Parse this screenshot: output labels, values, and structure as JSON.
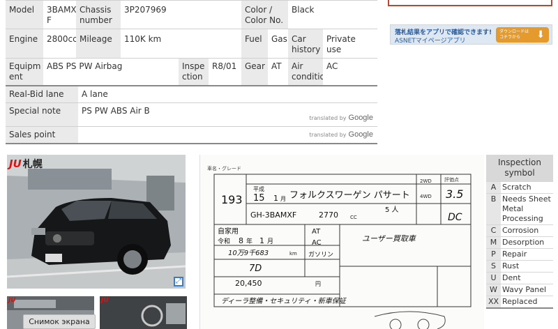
{
  "spec": {
    "model_label": "Model",
    "model_value": "3BAMX\nF",
    "chassis_label": "Chassis\nnumber",
    "chassis_value": "3P207969",
    "color_label": "Color /\nColor No.",
    "color_value": "Black",
    "engine_label": "Engine",
    "engine_value": "2800cc",
    "mileage_label": "Mileage",
    "mileage_value": "110K km",
    "fuel_label": "Fuel",
    "fuel_value": "Gas",
    "history_label": "Car\nhistory",
    "history_value": "Private\nuse",
    "equipment_label": "Equipm\nent",
    "equipment_value": "ABS PS PW Airbag",
    "inspection_label": "Inspe\nction",
    "inspection_value": "R8/01",
    "gear_label": "Gear",
    "gear_value": "AT",
    "aircon_label": "Air\nconditioner",
    "aircon_value": "AC"
  },
  "bid": {
    "lane_label": "Real-Bid lane",
    "lane_value": "A lane",
    "note_label": "Special note",
    "note_value": "PS PW ABS Air B",
    "sales_label": "Sales point",
    "sales_value": "",
    "translated_by": "translated by",
    "google": "Google"
  },
  "banner": {
    "line1": "落札結果をアプリで確認できます!",
    "line2": "ASNETマイページアプリ",
    "button": "ダウンロードは\nコチラから"
  },
  "photo": {
    "logo_brand": "JU",
    "logo_city": "札幌"
  },
  "thumbs": {
    "screenshot_label": "Снимок экрана"
  },
  "sheet": {
    "lot_number": "193",
    "era1": "平成",
    "year1": "15",
    "month1": "1",
    "month_unit": "月",
    "car_name": "フォルクスワーゲン パサート",
    "model_code": "GH-3BAMXF",
    "displacement": "2770",
    "cc": "CC",
    "seats": "5 人",
    "score": "3.5",
    "score_sub": "DC",
    "drive_2wd": "2WD",
    "drive_4wd": "4WD",
    "use": "自家用",
    "reiwa": "令和",
    "insp_year": "8",
    "year_unit": "年",
    "insp_month": "1",
    "shift": "AT",
    "aircon": "AC",
    "fuel": "ガソリン",
    "mileage_text": "10万9千683",
    "km": "km",
    "color_code": "7D",
    "price": "20,450",
    "price_unit": "円",
    "owner_note": "ユーザー買取車",
    "dealer_note": "ディーラ整備・セキュリティ・新車保証",
    "header_score": "評価点",
    "header_grade": "車名・グレード"
  },
  "inspection_symbols": {
    "title": "Inspection\nsymbol",
    "items": [
      {
        "code": "A",
        "desc": "Scratch"
      },
      {
        "code": "B",
        "desc": "Needs Sheet\nMetal\nProcessing"
      },
      {
        "code": "C",
        "desc": "Corrosion"
      },
      {
        "code": "M",
        "desc": "Desorption"
      },
      {
        "code": "P",
        "desc": "Repair"
      },
      {
        "code": "S",
        "desc": "Rust"
      },
      {
        "code": "U",
        "desc": "Dent"
      },
      {
        "code": "W",
        "desc": "Wavy Panel"
      },
      {
        "code": "XX",
        "desc": "Replaced"
      }
    ]
  }
}
